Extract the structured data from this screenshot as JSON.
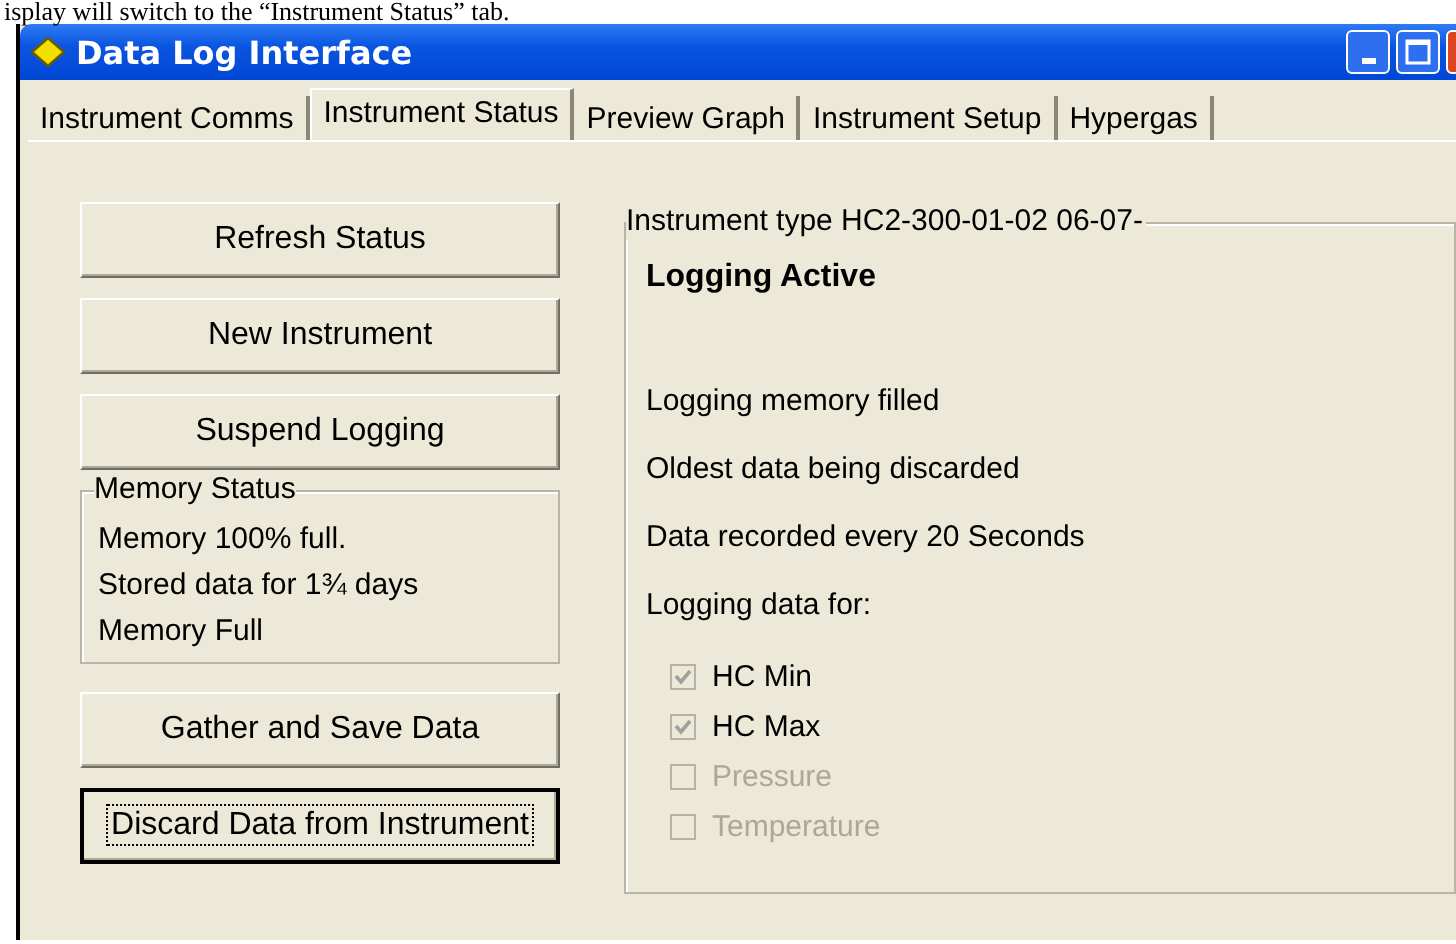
{
  "caption": "isplay will switch to the “Instrument Status” tab.",
  "window": {
    "title": "Data Log Interface"
  },
  "tabs": [
    {
      "label": "Instrument Comms",
      "selected": false
    },
    {
      "label": "Instrument Status",
      "selected": true
    },
    {
      "label": "Preview Graph",
      "selected": false
    },
    {
      "label": "Instrument Setup",
      "selected": false
    },
    {
      "label": "Hypergas",
      "selected": false
    }
  ],
  "top_buttons": [
    {
      "label": "Refresh Status",
      "focused": false
    },
    {
      "label": "New Instrument",
      "focused": false
    },
    {
      "label": "Suspend Logging",
      "focused": false
    }
  ],
  "memory_status": {
    "title": "Memory Status",
    "lines": [
      "Memory 100% full.",
      "Stored data for 1¾ days",
      "Memory Full"
    ]
  },
  "bottom_buttons": [
    {
      "label": "Gather and Save Data",
      "focused": false
    },
    {
      "label": "Discard Data from Instrument",
      "focused": true
    }
  ],
  "instrument": {
    "title": "Instrument type HC2-300-01-02 06-07-",
    "state": "Logging Active",
    "messages": [
      "Logging memory filled",
      "Oldest data being discarded",
      "Data recorded every 20 Seconds"
    ],
    "logging_label": "Logging data for:",
    "channels": [
      {
        "label": "HC Min",
        "checked": true,
        "disabled": false
      },
      {
        "label": "HC Max",
        "checked": true,
        "disabled": false
      },
      {
        "label": "Pressure",
        "checked": false,
        "disabled": true
      },
      {
        "label": "Temperature",
        "checked": false,
        "disabled": true
      }
    ]
  }
}
